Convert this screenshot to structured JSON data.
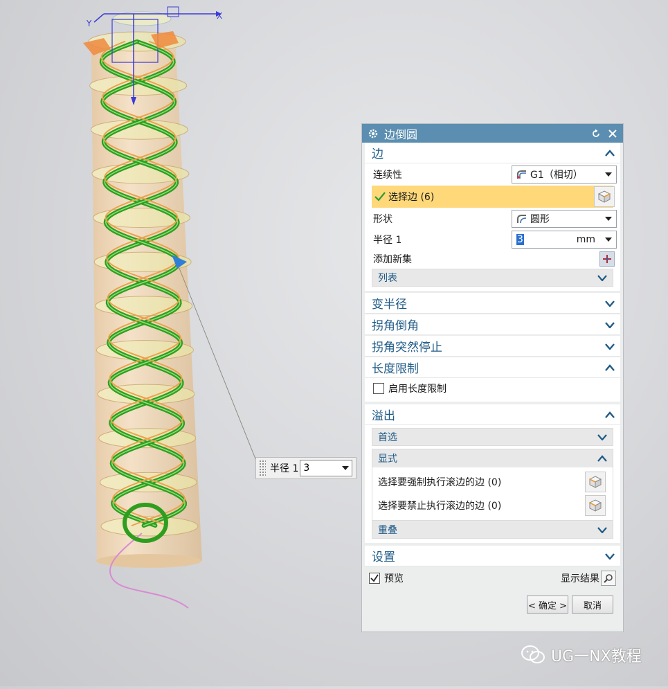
{
  "viewport": {
    "axis_x": "X",
    "axis_y": "Y"
  },
  "floating_input": {
    "label": "半径 1",
    "value": "3"
  },
  "dialog": {
    "title": "边倒圆",
    "sections": {
      "edge": {
        "label": "边",
        "continuity_label": "连续性",
        "continuity_value": "G1（相切）",
        "select_edge_label": "选择边 (6)",
        "shape_label": "形状",
        "shape_value": "圆形",
        "radius_label": "半径 1",
        "radius_value": "3",
        "radius_unit": "mm",
        "add_new_set_label": "添加新集",
        "list_label": "列表"
      },
      "variable_radius": {
        "label": "变半径"
      },
      "corner_setback": {
        "label": "拐角倒角"
      },
      "stop_short": {
        "label": "拐角突然停止"
      },
      "length_limit": {
        "label": "长度限制",
        "enable_label": "启用长度限制",
        "enabled": false
      },
      "overflow": {
        "label": "溢出",
        "preferred_label": "首选",
        "explicit_label": "显式",
        "force_roll_label": "选择要强制执行滚边的边 (0)",
        "prohibit_roll_label": "选择要禁止执行滚边的边 (0)",
        "overlap_label": "重叠"
      },
      "settings": {
        "label": "设置"
      }
    },
    "preview_label": "预览",
    "preview_checked": true,
    "show_result_label": "显示结果",
    "ok_label": "< 确定 >",
    "cancel_label": "取消"
  },
  "watermark": {
    "text": "UG一NX教程"
  },
  "colors": {
    "titlebar": "#5b8eb0",
    "section_text": "#1e5a86",
    "selected_highlight": "#ffd87a",
    "helix_green": "#3fae2a",
    "cylinder": "#f1d3ad"
  }
}
